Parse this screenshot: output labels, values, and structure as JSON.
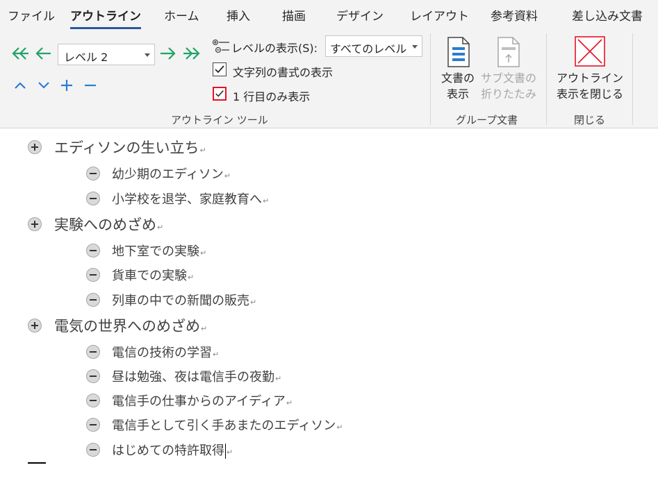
{
  "tabs": [
    {
      "label": "ファイル"
    },
    {
      "label": "アウトライン",
      "active": true
    },
    {
      "label": "ホーム"
    },
    {
      "label": "挿入"
    },
    {
      "label": "描画"
    },
    {
      "label": "デザイン"
    },
    {
      "label": "レイアウト"
    },
    {
      "label": "参考資料"
    },
    {
      "label": "差し込み文書"
    }
  ],
  "outline_tools": {
    "level_value": "レベル 2",
    "show_level_label": "レベルの表示(S):",
    "show_level_value": "すべてのレベル",
    "show_formatting_label": "文字列の書式の表示",
    "show_formatting_checked": true,
    "first_line_only_label": "1 行目のみ表示",
    "first_line_only_checked": true,
    "group_label": "アウトライン ツール",
    "icons": [
      "promote-to-heading1-icon",
      "promote-icon",
      "demote-icon",
      "demote-to-body-icon",
      "move-up-icon",
      "move-down-icon",
      "expand-icon",
      "collapse-icon"
    ],
    "accent_color": "#21a366"
  },
  "master_document": {
    "show_document_label_1": "文書の",
    "show_document_label_2": "表示",
    "collapse_sub_label_1": "サブ文書の",
    "collapse_sub_label_2": "折りたたみ",
    "group_label": "グループ文書"
  },
  "close": {
    "label_1": "アウトライン",
    "label_2": "表示を閉じる",
    "group_label": "閉じる",
    "icon_color": "#e81123"
  },
  "outline": [
    {
      "level": 1,
      "text": "エディソンの生い立ち",
      "children": [
        {
          "level": 2,
          "text": "幼少期のエディソン"
        },
        {
          "level": 2,
          "text": "小学校を退学、家庭教育へ"
        }
      ]
    },
    {
      "level": 1,
      "text": "実験へのめざめ",
      "children": [
        {
          "level": 2,
          "text": "地下室での実験"
        },
        {
          "level": 2,
          "text": "貨車での実験"
        },
        {
          "level": 2,
          "text": "列車の中での新聞の販売"
        }
      ]
    },
    {
      "level": 1,
      "text": "電気の世界へのめざめ",
      "children": [
        {
          "level": 2,
          "text": "電信の技術の学習"
        },
        {
          "level": 2,
          "text": "昼は勉強、夜は電信手の夜勤"
        },
        {
          "level": 2,
          "text": "電信手の仕事からのアイディア"
        },
        {
          "level": 2,
          "text": "電信手として引く手あまたのエディソン"
        },
        {
          "level": 2,
          "text": "はじめての特許取得"
        }
      ]
    }
  ],
  "paragraph_mark": "↵"
}
